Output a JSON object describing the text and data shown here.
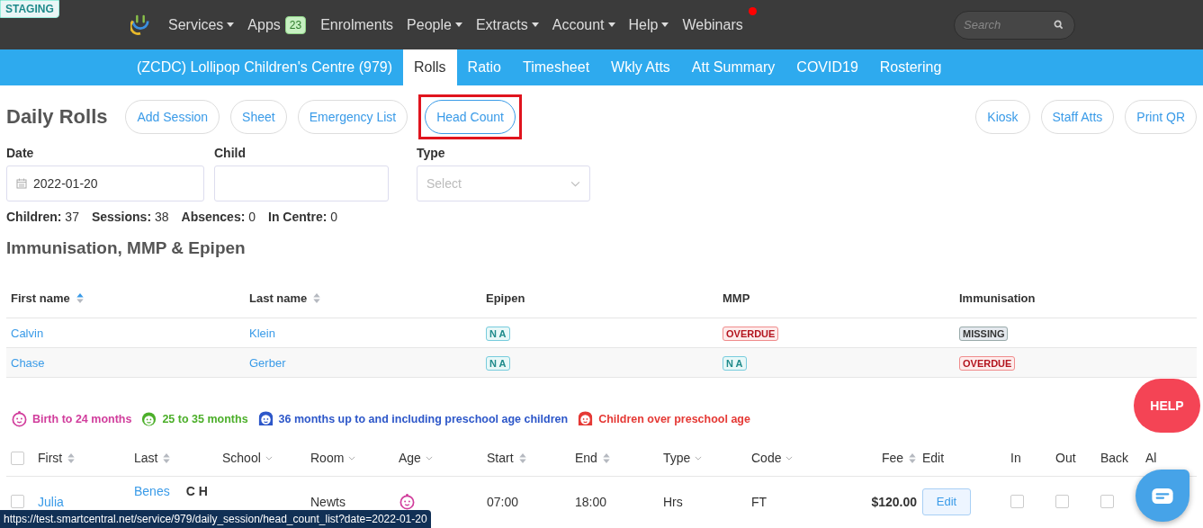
{
  "staging_badge": "STAGING",
  "top_nav": {
    "items": [
      {
        "label": "Services",
        "dropdown": true
      },
      {
        "label": "Apps",
        "dropdown": false,
        "badge": "23"
      },
      {
        "label": "Enrolments",
        "dropdown": false
      },
      {
        "label": "People",
        "dropdown": true
      },
      {
        "label": "Extracts",
        "dropdown": true
      },
      {
        "label": "Account",
        "dropdown": true
      },
      {
        "label": "Help",
        "dropdown": true
      },
      {
        "label": "Webinars",
        "dropdown": false,
        "notification": true
      }
    ],
    "search": {
      "placeholder": "Search"
    }
  },
  "sub_nav": {
    "centre": "(ZCDC) Lollipop Children's Centre (979)",
    "tabs": [
      {
        "label": "Rolls",
        "selected": true
      },
      {
        "label": "Ratio",
        "selected": false
      },
      {
        "label": "Timesheet",
        "selected": false
      },
      {
        "label": "Wkly Atts",
        "selected": false
      },
      {
        "label": "Att Summary",
        "selected": false
      },
      {
        "label": "COVID19",
        "selected": false
      },
      {
        "label": "Rostering",
        "selected": false
      }
    ]
  },
  "page_title": "Daily Rolls",
  "actions": [
    {
      "label": "Add Session",
      "highlighted": false
    },
    {
      "label": "Sheet",
      "highlighted": false
    },
    {
      "label": "Emergency List",
      "highlighted": false
    },
    {
      "label": "Head Count",
      "highlighted": true
    }
  ],
  "right_actions": [
    {
      "label": "Kiosk"
    },
    {
      "label": "Staff Atts"
    },
    {
      "label": "Print QR"
    }
  ],
  "filters": {
    "date": {
      "label": "Date",
      "value": "2022-01-20"
    },
    "child": {
      "label": "Child"
    },
    "type": {
      "label": "Type",
      "placeholder": "Select"
    }
  },
  "stats": [
    {
      "label": "Children:",
      "value": "37"
    },
    {
      "label": "Sessions:",
      "value": "38"
    },
    {
      "label": "Absences:",
      "value": "0"
    },
    {
      "label": "In Centre:",
      "value": "0"
    }
  ],
  "immunisation": {
    "heading": "Immunisation, MMP & Epipen",
    "columns": [
      {
        "label": "First name",
        "sortable": true,
        "sort_active": true
      },
      {
        "label": "Last name",
        "sortable": true,
        "sort_active": false
      },
      {
        "label": "Epipen",
        "sortable": false
      },
      {
        "label": "MMP",
        "sortable": false
      },
      {
        "label": "Immunisation",
        "sortable": false
      }
    ],
    "rows": [
      {
        "first": "Calvin",
        "last": "Klein",
        "epipen": {
          "text": "N A",
          "kind": "na"
        },
        "mmp": {
          "text": "OVERDUE",
          "kind": "overdue"
        },
        "immunisation": {
          "text": "MISSING",
          "kind": "missing"
        }
      },
      {
        "first": "Chase",
        "last": "Gerber",
        "epipen": {
          "text": "N A",
          "kind": "na"
        },
        "mmp": {
          "text": "N A",
          "kind": "na"
        },
        "immunisation": {
          "text": "OVERDUE",
          "kind": "overdue"
        }
      }
    ]
  },
  "legend": [
    {
      "label": "Birth to 24 months",
      "kind": "baby",
      "color": "#d13d9c"
    },
    {
      "label": "25 to 35 months",
      "kind": "boy",
      "color": "#4caf2a"
    },
    {
      "label": "36 months up to and including preschool age children",
      "kind": "girl",
      "color": "#2d57c9"
    },
    {
      "label": "Children over preschool age",
      "kind": "girl",
      "color": "#e53935"
    }
  ],
  "sessions": {
    "select_all": false,
    "columns": [
      {
        "label": "First",
        "kind": "sort"
      },
      {
        "label": "Last",
        "kind": "sort"
      },
      {
        "label": "School",
        "kind": "filter"
      },
      {
        "label": "Room",
        "kind": "filter"
      },
      {
        "label": "Age",
        "kind": "filter"
      },
      {
        "label": "Start",
        "kind": "sort"
      },
      {
        "label": "End",
        "kind": "sort"
      },
      {
        "label": "Type",
        "kind": "filter"
      },
      {
        "label": "Code",
        "kind": "filter"
      },
      {
        "label": "Fee",
        "kind": "sort"
      },
      {
        "label": "Edit",
        "kind": "plain"
      },
      {
        "label": "In",
        "kind": "plain"
      },
      {
        "label": "Out",
        "kind": "plain"
      },
      {
        "label": "Back",
        "kind": "plain"
      },
      {
        "label": "Al",
        "kind": "plain"
      }
    ],
    "rows": [
      {
        "selected": false,
        "first": "Julia",
        "last": "Benes",
        "tag": "C H",
        "room": "Newts",
        "age": {
          "kind": "baby",
          "color": "#d13d9c"
        },
        "start": "07:00",
        "end": "18:00",
        "type": "Hrs",
        "code": "FT",
        "fee": "$120.00",
        "edit": "Edit",
        "in": false,
        "out": false,
        "back": false
      }
    ]
  },
  "help_button": "HELP",
  "status_url": "https://test.smartcentral.net/service/979/daily_session/head_count_list?date=2022-01-20"
}
